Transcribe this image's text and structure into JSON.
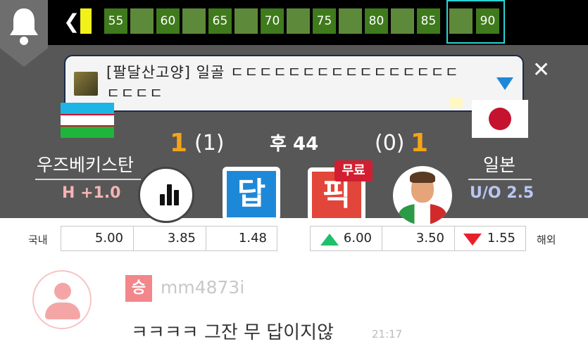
{
  "timeline": {
    "back_label": "❮",
    "ticks": [
      "55",
      "",
      "60",
      "",
      "65",
      "",
      "70",
      "",
      "75",
      "",
      "80",
      "",
      "85",
      "",
      "90"
    ]
  },
  "notice": {
    "text": "[팔달산고양] 일골 ㄷㄷㄷㄷㄷㄷㄷㄷㄷㄷㄷㄷㄷㄷㄷㄷㄷㄷㄷㄷ",
    "close_label": "✕"
  },
  "match": {
    "home": {
      "name": "우즈베키스탄",
      "score": "1",
      "half_score": "(1)",
      "handicap": "H +1.0",
      "flag_colors": [
        "#1eb4e6",
        "#ffffff",
        "#1eb53a"
      ]
    },
    "away": {
      "name": "일본",
      "score": "1",
      "half_score": "(0)",
      "overunder": "U/O 2.5",
      "flag_colors": [
        "#ffffff",
        "#c4122f"
      ]
    },
    "period": "후 44"
  },
  "actions": {
    "answer_label": "답",
    "pick_label": "픽",
    "free_label": "무료"
  },
  "odds": {
    "domestic_label": "국내",
    "overseas_label": "해외",
    "domestic": [
      "5.00",
      "3.85",
      "1.48"
    ],
    "overseas": [
      "6.00",
      "3.50",
      "1.55"
    ]
  },
  "comment": {
    "badge": "승",
    "username": "mm4873i",
    "text": "ㅋㅋㅋㅋ 그잔 무 답이지않",
    "time": "21:17"
  },
  "colors": {
    "score": "#f4a418",
    "accent_blue": "#1e88d8",
    "pick_red": "#e2453a",
    "tick_green": "#3f7a1c",
    "highlight": "#2ad4d4"
  }
}
